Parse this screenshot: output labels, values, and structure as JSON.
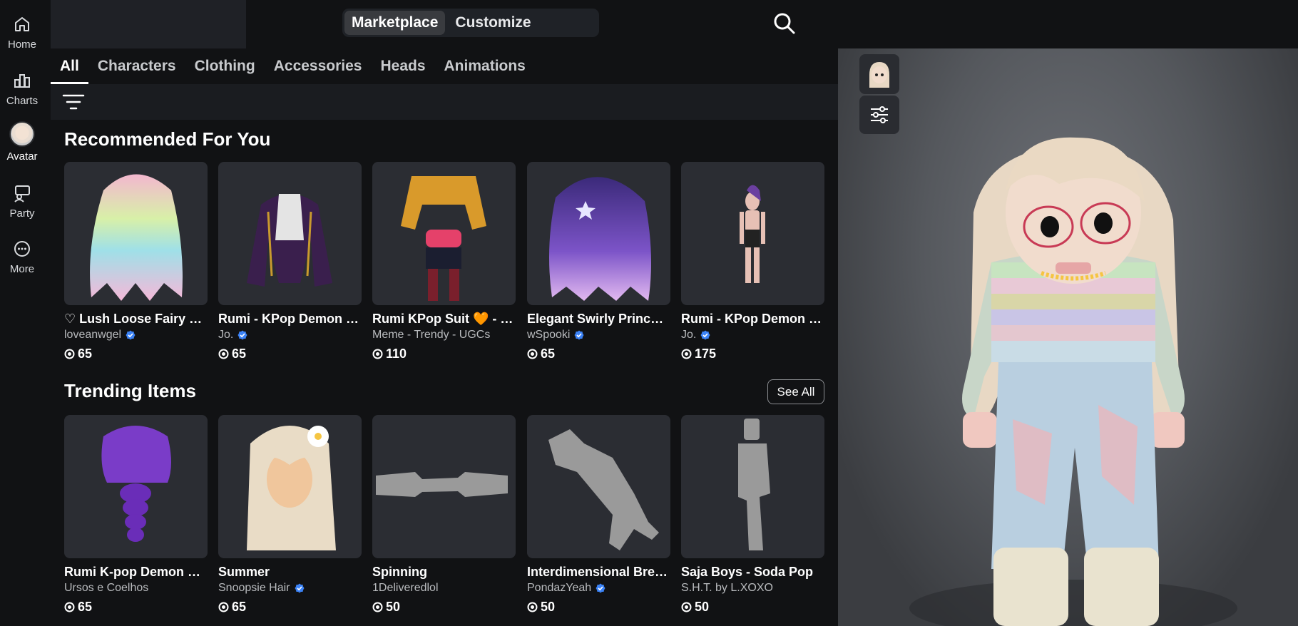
{
  "rail": {
    "items": [
      {
        "label": "Home",
        "icon": "home-icon"
      },
      {
        "label": "Charts",
        "icon": "charts-icon"
      },
      {
        "label": "Avatar",
        "icon": "avatar-icon"
      },
      {
        "label": "Party",
        "icon": "party-icon"
      },
      {
        "label": "More",
        "icon": "more-icon"
      }
    ]
  },
  "header": {
    "segments": [
      {
        "label": "Marketplace",
        "active": true
      },
      {
        "label": "Customize",
        "active": false
      }
    ]
  },
  "tabs": [
    {
      "label": "All",
      "active": true
    },
    {
      "label": "Characters"
    },
    {
      "label": "Clothing"
    },
    {
      "label": "Accessories"
    },
    {
      "label": "Heads"
    },
    {
      "label": "Animations"
    }
  ],
  "sections": {
    "recommended": {
      "title": "Recommended For You",
      "items": [
        {
          "name": "♡ Lush Loose Fairy Wa...",
          "creator": "loveanwgel",
          "verified": true,
          "price": "65"
        },
        {
          "name": "Rumi - KPop Demon Hu...",
          "creator": "Jo.",
          "verified": true,
          "price": "65"
        },
        {
          "name": "Rumi KPop Suit 🧡 - De...",
          "creator": "Meme - Trendy - UGCs",
          "verified": false,
          "price": "110"
        },
        {
          "name": "Elegant Swirly Princes...",
          "creator": "wSpooki",
          "verified": true,
          "price": "65"
        },
        {
          "name": "Rumi - KPop Demon Hu...",
          "creator": "Jo.",
          "verified": true,
          "price": "175"
        }
      ]
    },
    "trending": {
      "title": "Trending Items",
      "see_all": "See All",
      "items": [
        {
          "name": "Rumi K-pop Demon Hu...",
          "creator": "Ursos e Coelhos",
          "verified": false,
          "price": "65"
        },
        {
          "name": "Summer",
          "creator": "Snoopsie Hair",
          "verified": true,
          "price": "65"
        },
        {
          "name": "Spinning",
          "creator": "1Deliveredlol",
          "verified": false,
          "price": "50"
        },
        {
          "name": "Interdimensional Brea...",
          "creator": "PondazYeah",
          "verified": true,
          "price": "50"
        },
        {
          "name": "Saja Boys - Soda Pop",
          "creator": "S.H.T. by L.XOXO",
          "verified": false,
          "price": "50"
        }
      ]
    }
  },
  "colors": {
    "background": "#111214",
    "card": "#2b2d33",
    "verified": "#3b82f6",
    "preview_bg": "#55585d"
  }
}
